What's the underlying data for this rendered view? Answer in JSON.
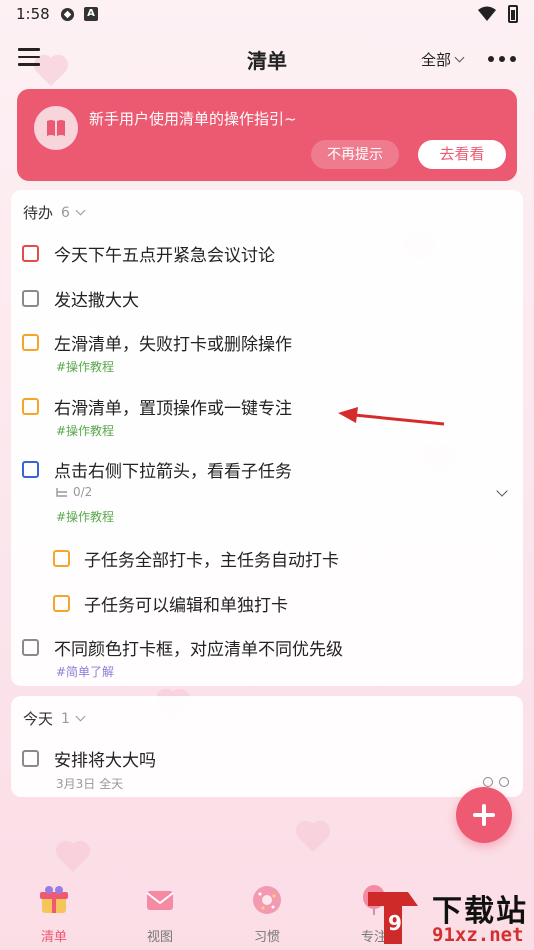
{
  "status_bar": {
    "time": "1:58",
    "icon_b": "A"
  },
  "header": {
    "title": "清单",
    "filter_label": "全部"
  },
  "guide": {
    "text": "新手用户使用清单的操作指引~",
    "dismiss_label": "不再提示",
    "view_label": "去看看"
  },
  "todo_section": {
    "title": "待办",
    "count": "6",
    "tasks": [
      {
        "title": "今天下午五点开紧急会议讨论",
        "priority_color": "#e54b4b"
      },
      {
        "title": "发达撒大大",
        "priority_color": "#8a8a8a"
      },
      {
        "title": "左滑清单，失败打卡或删除操作",
        "tag": "#操作教程",
        "priority_color": "#f4a62a"
      },
      {
        "title": "右滑清单，置顶操作或一键专注",
        "tag": "#操作教程",
        "priority_color": "#f4a62a"
      },
      {
        "title": "点击右侧下拉箭头，看看子任务",
        "subtask_progress": "0/2",
        "tag": "#操作教程",
        "priority_color": "#3a63d6"
      },
      {
        "title": "子任务全部打卡，主任务自动打卡",
        "priority_color": "#f4a62a"
      },
      {
        "title": "子任务可以编辑和单独打卡",
        "priority_color": "#f4a62a"
      },
      {
        "title": "不同颜色打卡框，对应清单不同优先级",
        "tag": "#简单了解",
        "priority_color": "#8a8a8a"
      }
    ]
  },
  "today_section": {
    "title": "今天",
    "count": "1",
    "tasks": [
      {
        "title": "安排将大大吗",
        "date": "3月3日 全天",
        "priority_color": "#8a8a8a"
      }
    ]
  },
  "bottom_nav": [
    {
      "label": "清单",
      "icon": "gift-list-icon",
      "active": true
    },
    {
      "label": "视图",
      "icon": "envelope-view-icon",
      "active": false
    },
    {
      "label": "习惯",
      "icon": "donut-habit-icon",
      "active": false
    },
    {
      "label": "专注",
      "icon": "balloon-focus-icon",
      "active": false
    }
  ],
  "watermark": {
    "main": "下载站",
    "sub": "91xz.net"
  },
  "colors": {
    "accent": "#ec5a72",
    "tag_green": "#5aa84b",
    "tag_purple": "#8a7fd6"
  }
}
